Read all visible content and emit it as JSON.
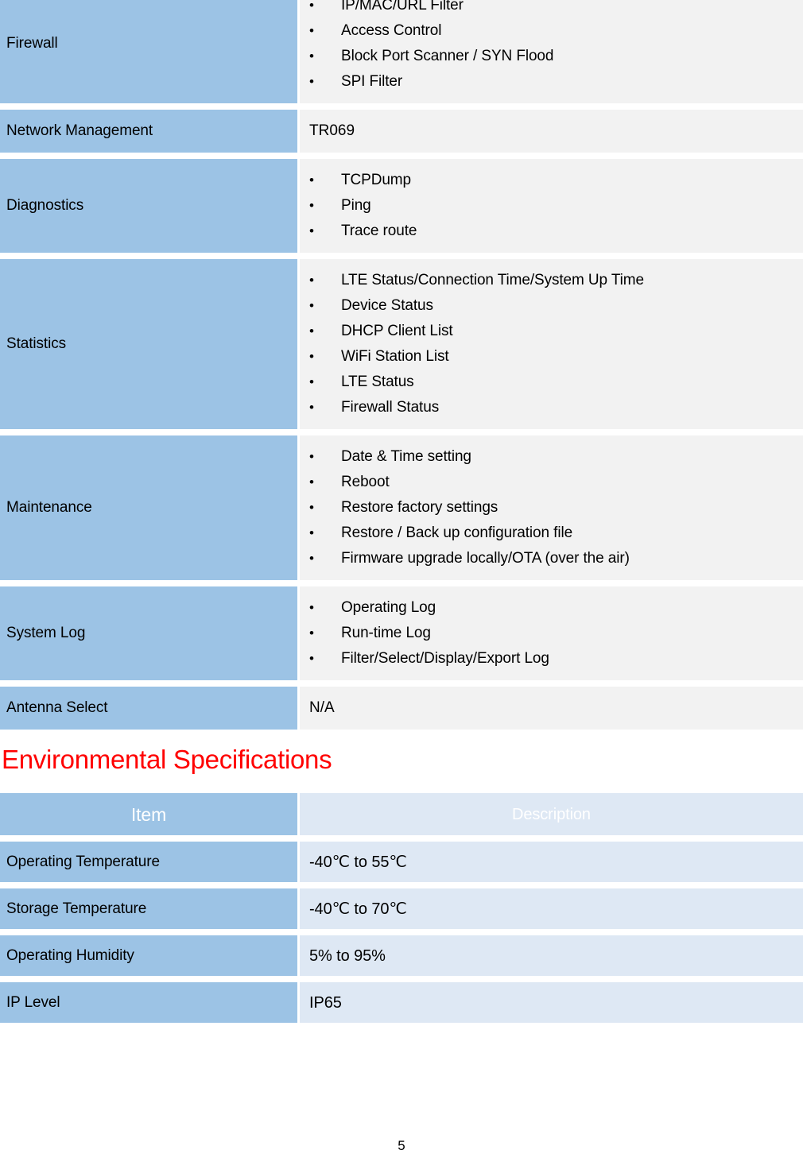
{
  "page": {
    "number": "5"
  },
  "colors": {
    "header_blue": "#5B9BD5",
    "label_blue": "#9CC3E5",
    "value_gray": "#F2F2F2",
    "value_light_blue": "#DEE8F4",
    "heading_red": "#FF0000"
  },
  "features_table": {
    "rows": [
      {
        "label": "Firewall",
        "type": "bullets",
        "items": [
          "IP/MAC/URL Filter",
          "Access Control",
          "Block Port Scanner / SYN Flood",
          "SPI Filter"
        ]
      },
      {
        "label": "Network Management",
        "type": "text",
        "value": "TR069"
      },
      {
        "label": "Diagnostics",
        "type": "bullets",
        "items": [
          "TCPDump",
          "Ping",
          "Trace route"
        ]
      },
      {
        "label": "Statistics",
        "type": "bullets",
        "items": [
          "LTE Status/Connection Time/System Up Time",
          "Device Status",
          "DHCP Client List",
          "WiFi Station List",
          "LTE Status",
          "Firewall Status"
        ]
      },
      {
        "label": "Maintenance",
        "type": "bullets",
        "items": [
          "Date & Time setting",
          "Reboot",
          "Restore factory settings",
          "Restore / Back up configuration file",
          "Firmware upgrade locally/OTA (over the air)"
        ]
      },
      {
        "label": "System Log",
        "type": "bullets",
        "items": [
          "Operating Log",
          "Run-time Log",
          "Filter/Select/Display/Export Log"
        ]
      },
      {
        "label": "Antenna Select",
        "type": "text",
        "value": "N/A"
      }
    ]
  },
  "environmental_section": {
    "heading": "Environmental Specifications",
    "table": {
      "headers": {
        "item": "Item",
        "description": "Description"
      },
      "rows": [
        {
          "label": "Operating Temperature",
          "value": "-40℃ to 55℃"
        },
        {
          "label": "Storage Temperature",
          "value": "-40℃ to 70℃"
        },
        {
          "label": "Operating Humidity",
          "value": "5% to 95%"
        },
        {
          "label": "IP Level",
          "value": "IP65"
        }
      ]
    }
  }
}
